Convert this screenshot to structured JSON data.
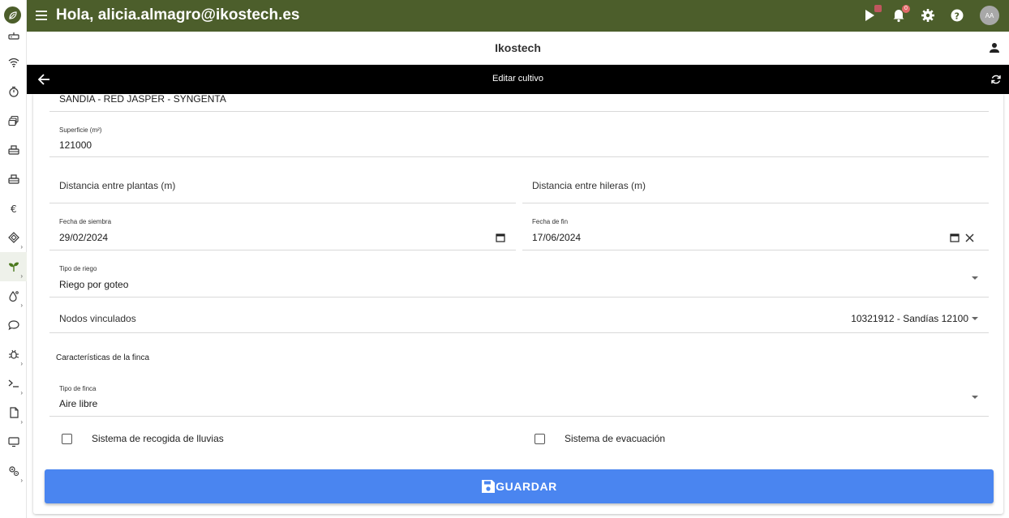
{
  "header": {
    "greeting": "Hola, alicia.almagro@ikostech.es",
    "notifications_count": "0",
    "avatar_initials": "AA",
    "brand_color": "#4c5e2b"
  },
  "company": {
    "name": "Ikostech"
  },
  "titlebar": {
    "title": "Editar cultivo"
  },
  "sidebar": {
    "items": [
      {
        "icon": "router-icon"
      },
      {
        "icon": "wifi-icon"
      },
      {
        "icon": "timer-icon"
      },
      {
        "icon": "layers-icon"
      },
      {
        "icon": "device-icon"
      },
      {
        "icon": "device-icon"
      },
      {
        "icon": "euro-icon"
      },
      {
        "icon": "connect-icon"
      },
      {
        "icon": "sprout-icon",
        "active": true
      },
      {
        "icon": "drop-icon"
      },
      {
        "icon": "chat-icon"
      },
      {
        "icon": "bug-icon"
      },
      {
        "icon": "terminal-icon"
      },
      {
        "icon": "document-icon"
      },
      {
        "icon": "monitor-icon"
      },
      {
        "icon": "settings-icon"
      }
    ]
  },
  "form": {
    "crop_value": "SANDIA - RED JASPER - SYNGENTA",
    "surface_label": "Superficie (m²)",
    "surface_value": "121000",
    "plant_distance_placeholder": "Distancia entre plantas (m)",
    "row_distance_placeholder": "Distancia entre hileras (m)",
    "sowing_date_label": "Fecha de siembra",
    "sowing_date_value": "29/02/2024",
    "end_date_label": "Fecha de fin",
    "end_date_value": "17/06/2024",
    "irrigation_label": "Tipo de riego",
    "irrigation_value": "Riego por goteo",
    "nodes_label": "Nodos vinculados",
    "nodes_value": "10321912 - Sandías 12100",
    "farm_section_title": "Características de la finca",
    "farm_type_label": "Tipo de finca",
    "farm_type_value": "Aire libre",
    "rain_collection_label": "Sistema de recogida de lluvias",
    "rain_collection_checked": false,
    "evacuation_label": "Sistema de evacuación",
    "evacuation_checked": false,
    "save_label": "GUARDAR",
    "save_color": "#4a85f0"
  }
}
